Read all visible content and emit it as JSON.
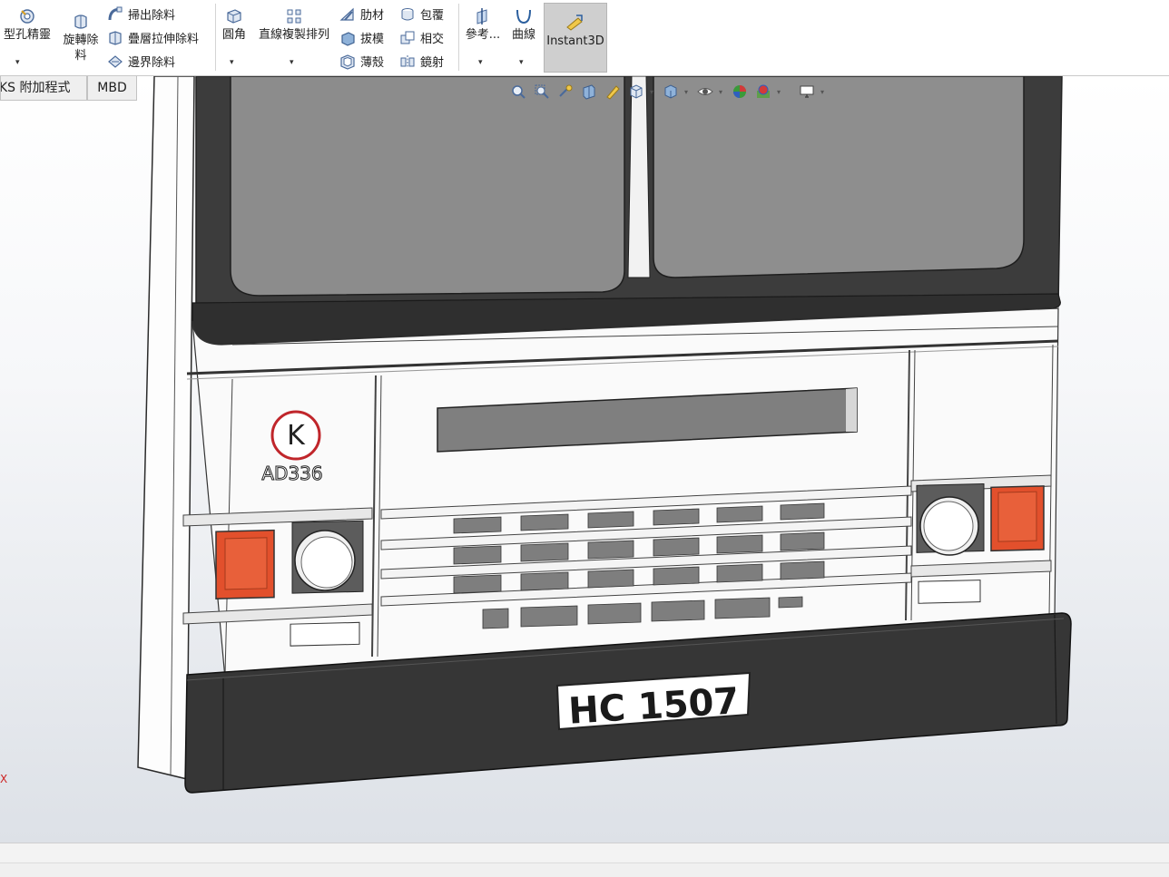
{
  "ribbon": {
    "hole_wizard": "型孔精靈",
    "revolve_cut_line1": "旋轉除",
    "revolve_cut_line2": "料",
    "swept_cut": "掃出除料",
    "lofted_cut": "疊層拉伸除料",
    "boundary_cut": "邊界除料",
    "fillet": "圓角",
    "linear_pattern": "直線複製排列",
    "rib": "肋材",
    "draft": "拔模",
    "shell": "薄殼",
    "wrap": "包覆",
    "intersect": "相交",
    "mirror": "鏡射",
    "reference": "參考...",
    "curves": "曲線",
    "instant3d": "Instant3D",
    "dropdown_arrow": "▾"
  },
  "tabs": {
    "addins": "KS 附加程式",
    "mbd": "MBD"
  },
  "model": {
    "logo_letter": "K",
    "fleet_number": "AD336",
    "license_plate": "HC 1507"
  },
  "triad": {
    "x_label": "X"
  },
  "colors": {
    "ribbon_bg": "#ffffff",
    "active_button": "#cfcfcf",
    "glass": "#8c8c8c",
    "frame_dark": "#3a3a3a",
    "tail_light": "#e2502c",
    "bumper": "#363636",
    "logo_red": "#c0262b"
  }
}
